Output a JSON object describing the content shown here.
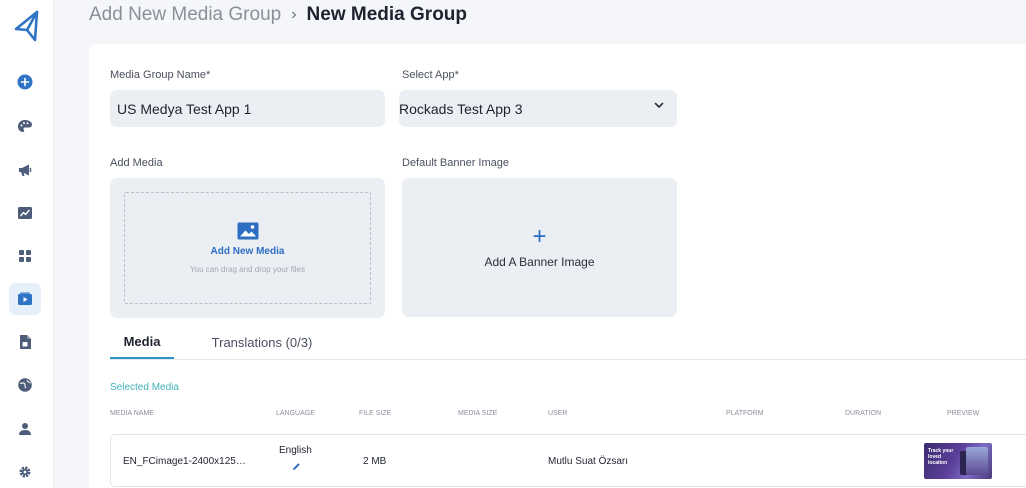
{
  "header": {
    "breadcrumb_parent": "Add New Media Group",
    "breadcrumb_separator": "›",
    "title": "New Media Group"
  },
  "sidebar": {
    "items": [
      {
        "icon": "add-circle-icon"
      },
      {
        "icon": "palette-icon"
      },
      {
        "icon": "megaphone-icon"
      },
      {
        "icon": "chart-icon"
      },
      {
        "icon": "grid-icon"
      },
      {
        "icon": "play-video-icon",
        "active": true
      },
      {
        "icon": "document-icon"
      },
      {
        "icon": "globe-icon"
      },
      {
        "icon": "user-icon"
      },
      {
        "icon": "settings-icon"
      }
    ]
  },
  "form": {
    "group_name_label": "Media Group Name*",
    "group_name_value": "US Medya Test App 1",
    "app_label": "Select App*",
    "app_value": "Rockads Test App 3",
    "add_media_label": "Add Media",
    "add_media_title": "Add New Media",
    "add_media_hint": "You can drag and drop your files",
    "banner_label": "Default Banner Image",
    "banner_plus": "+",
    "banner_text": "Add A Banner Image"
  },
  "tabs": [
    {
      "label": "Media",
      "active": true
    },
    {
      "label": "Translations (0/3)",
      "active": false
    }
  ],
  "media_table": {
    "title": "Selected Media",
    "columns": [
      "MEDIA NAME",
      "LANGUAGE",
      "FILE SIZE",
      "MEDIA SIZE",
      "USER",
      "PLATFORM",
      "DURATION",
      "PREVIEW"
    ],
    "rows": [
      {
        "media_name": "EN_FCimage1-2400x125…",
        "language": "English",
        "file_size": "2 MB",
        "media_size": "",
        "user": "Mutlu Suat Özsarı",
        "platform": "",
        "duration": "",
        "preview_text": "Track your loved location"
      }
    ]
  },
  "colors": {
    "accent": "#2d6ec3",
    "tab_indicator": "#2b95c5",
    "section_title": "#3fb2b8",
    "field_bg": "#ebeef2"
  }
}
